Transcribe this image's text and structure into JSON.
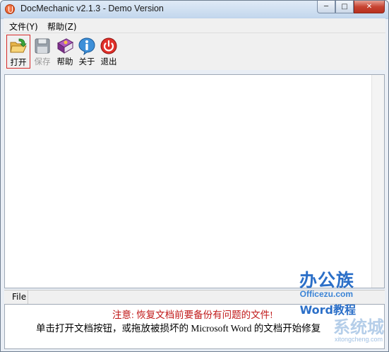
{
  "window": {
    "title": "DocMechanic v2.1.3 - Demo Version",
    "caption_minimize": "─",
    "caption_maximize": "□",
    "caption_close": "✕"
  },
  "menu": {
    "items": [
      {
        "label": "文件(Y)"
      },
      {
        "label": "帮助(Z)"
      }
    ]
  },
  "toolbar": {
    "items": [
      {
        "label": "打开",
        "icon": "open-folder-icon",
        "state": "active"
      },
      {
        "label": "保存",
        "icon": "save-disk-icon",
        "state": "disabled"
      },
      {
        "label": "帮助",
        "icon": "help-book-icon",
        "state": "normal"
      },
      {
        "label": "关于",
        "icon": "info-icon",
        "state": "normal"
      },
      {
        "label": "退出",
        "icon": "power-exit-icon",
        "state": "normal"
      }
    ]
  },
  "bottom_panel": {
    "tab_label": "File",
    "notice": "注意: 恢复文档前要备份有问题的文件!",
    "instruction": "单击打开文档按钮，或拖放被损坏的 Microsoft Word 的文档开始修复"
  },
  "watermark": {
    "title": "办公族",
    "domain": "Officezu.com",
    "subtitle": "Word教程",
    "brand": "系统城",
    "url": "xitongcheng.com"
  },
  "colors": {
    "notice_red": "#c01818",
    "active_outline": "#d62a2a",
    "close_button": "#c74432"
  }
}
